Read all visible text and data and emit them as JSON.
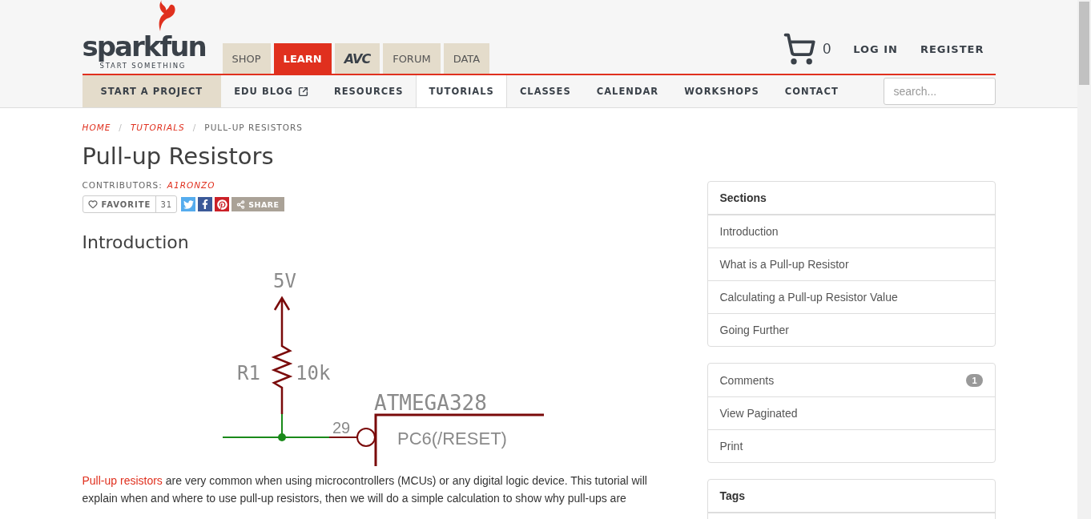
{
  "logo": {
    "name": "sparkfun",
    "tagline": "START SOMETHING"
  },
  "main_tabs": [
    {
      "label": "SHOP",
      "kind": "text",
      "selected": false
    },
    {
      "label": "LEARN",
      "kind": "text",
      "selected": true
    },
    {
      "label": "AVC",
      "kind": "logo",
      "selected": false
    },
    {
      "label": "FORUM",
      "kind": "text",
      "selected": false
    },
    {
      "label": "DATA",
      "kind": "text",
      "selected": false
    }
  ],
  "cart": {
    "count": "0"
  },
  "account_links": [
    "LOG IN",
    "REGISTER"
  ],
  "sub_nav": [
    {
      "label": "START A PROJECT",
      "kind": "feature",
      "selected": false
    },
    {
      "label": "EDU BLOG",
      "kind": "external",
      "selected": false
    },
    {
      "label": "RESOURCES",
      "kind": "plain",
      "selected": false
    },
    {
      "label": "TUTORIALS",
      "kind": "plain",
      "selected": true
    },
    {
      "label": "CLASSES",
      "kind": "plain",
      "selected": false
    },
    {
      "label": "CALENDAR",
      "kind": "plain",
      "selected": false
    },
    {
      "label": "WORKSHOPS",
      "kind": "plain",
      "selected": false
    },
    {
      "label": "CONTACT",
      "kind": "plain",
      "selected": false
    }
  ],
  "search": {
    "placeholder": "search..."
  },
  "breadcrumb": [
    {
      "label": "HOME",
      "kind": "link"
    },
    {
      "label": "/",
      "kind": "separator"
    },
    {
      "label": "TUTORIALS",
      "kind": "link"
    },
    {
      "label": "/",
      "kind": "separator"
    },
    {
      "label": "PULL-UP RESISTORS",
      "kind": "current"
    }
  ],
  "title": "Pull-up Resistors",
  "contributors": {
    "label": "CONTRIBUTORS:",
    "names": [
      "A1RONZO"
    ]
  },
  "favorite": {
    "label": "FAVORITE",
    "count": "31"
  },
  "share": {
    "label": "SHARE"
  },
  "section_heading": "Introduction",
  "schematic": {
    "supply": "5V",
    "resistor_name": "R1",
    "resistor_value": "10k",
    "chip": "ATMEGA328",
    "pin_number": "29",
    "pin_name": "PC6(/RESET)"
  },
  "intro": {
    "link": "Pull-up resistors",
    "text": " are very common when using microcontrollers (MCUs) or any digital logic device. This tutorial will explain when and where to use pull-up resistors, then we will do a simple calculation to show why pull-ups are"
  },
  "sidebar": {
    "sections": {
      "title": "Sections",
      "items": [
        "Introduction",
        "What is a Pull-up Resistor",
        "Calculating a Pull-up Resistor Value",
        "Going Further"
      ]
    },
    "actions": [
      {
        "label": "Comments",
        "badge": "1"
      },
      {
        "label": "View Paginated"
      },
      {
        "label": "Print"
      }
    ],
    "tags": {
      "title": "Tags"
    }
  }
}
